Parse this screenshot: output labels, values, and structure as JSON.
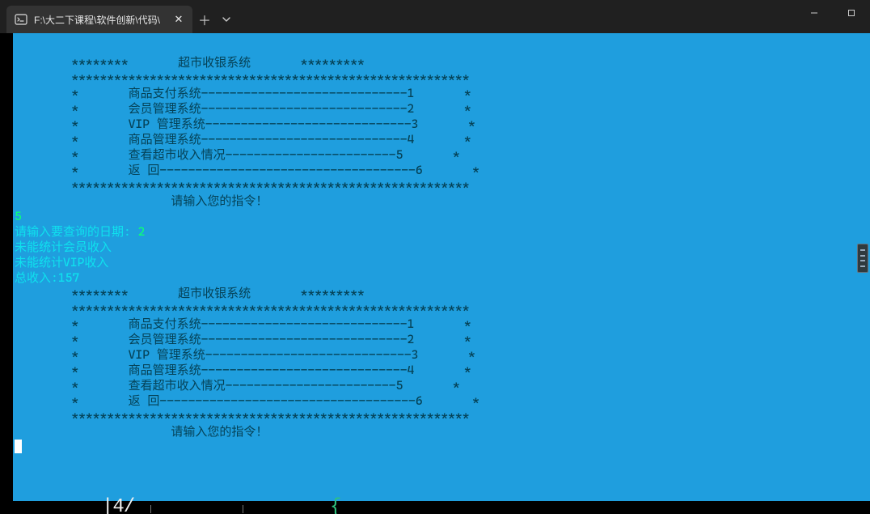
{
  "window": {
    "tab_title": "F:\\大二下课程\\软件创新\\代码\\",
    "new_tab_tooltip": "New tab",
    "close_tab_tooltip": "Close tab",
    "tab_menu_tooltip": "Tab menu",
    "minimize_tooltip": "Minimize",
    "maximize_tooltip": "Maximize",
    "close_window_tooltip": "Close"
  },
  "icons": {
    "terminal": "terminal-icon",
    "close": "✕",
    "plus": "＋",
    "chevron_down": "⌄"
  },
  "menu1": {
    "banner_left": "        ********",
    "banner_title": "       超市收银系统",
    "banner_right": "       *********",
    "divider": "        ********************************************************",
    "item1": "        *       商品支付系统-----------------------------1       *",
    "item2": "        *       会员管理系统-----------------------------2       *",
    "item3": "        *       VIP 管理系统-----------------------------3       *",
    "item4": "        *       商品管理系统-----------------------------4       *",
    "item5": "        *       查看超市收入情况------------------------5       *",
    "item6": "        *       返 回------------------------------------6       *",
    "prompt": "                      请输入您的指令！"
  },
  "io": {
    "cmd_input": "5",
    "ask_date_label": "请输入要查询的日期: ",
    "ask_date_value": "2",
    "line_member": "未能统计会员收入",
    "line_vip": "未能统计VIP收入",
    "total_label": "总收入:",
    "total_value": "157"
  },
  "menu2": {
    "banner_left": "        ********",
    "banner_title": "       超市收银系统",
    "banner_right": "       *********",
    "divider": "        ********************************************************",
    "item1": "        *       商品支付系统-----------------------------1       *",
    "item2": "        *       会员管理系统-----------------------------2       *",
    "item3": "        *       VIP 管理系统-----------------------------3       *",
    "item4": "        *       商品管理系统-----------------------------4       *",
    "item5": "        *       查看超市收入情况------------------------5       *",
    "item6": "        *       返 回------------------------------------6       *",
    "prompt": "                      请输入您的指令！"
  },
  "bottom": {
    "frag1": "|4/",
    "frag4_brace": "{"
  },
  "colors": {
    "terminal_bg": "#1f9ede",
    "fg_cyan": "#0fe1ee",
    "fg_green": "#0bff77",
    "fg_dark": "#054257",
    "titlebar_bg": "#202020",
    "tab_bg": "#333333"
  }
}
